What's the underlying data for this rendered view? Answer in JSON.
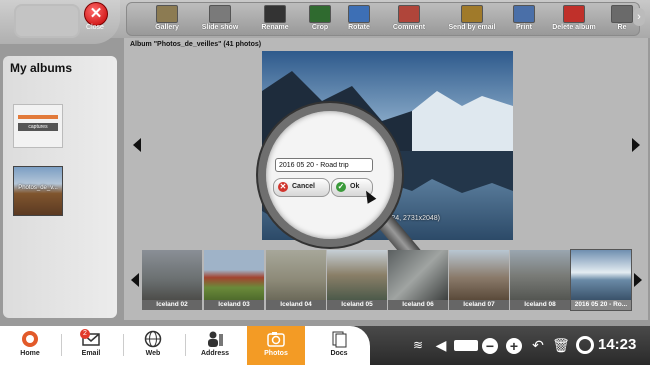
{
  "toolbar": {
    "close_label": "Close",
    "items": [
      {
        "label": "Gallery",
        "icon": "gallery-icon",
        "color": "#8c7b52"
      },
      {
        "label": "Slide show",
        "icon": "slideshow-icon",
        "color": "#7a7a7a"
      },
      {
        "label": "Rename",
        "icon": "rename-icon",
        "color": "#333333"
      },
      {
        "label": "Crop",
        "icon": "crop-icon",
        "color": "#2f6a2f"
      },
      {
        "label": "Rotate",
        "icon": "rotate-icon",
        "color": "#3d6fb5"
      },
      {
        "label": "Comment",
        "icon": "comment-icon",
        "color": "#b0453a"
      },
      {
        "label": "Send by email",
        "icon": "send-email-icon",
        "color": "#a07a2a"
      },
      {
        "label": "Print",
        "icon": "print-icon",
        "color": "#4a6fa8"
      },
      {
        "label": "Delete album",
        "icon": "delete-album-icon",
        "color": "#c0302a"
      },
      {
        "label": "Re",
        "icon": "more-icon",
        "color": "#6a6a6a"
      }
    ]
  },
  "sidebar": {
    "title": "My albums",
    "albums": [
      {
        "name": "captures"
      },
      {
        "name": "Photos_de_v..."
      }
    ]
  },
  "viewer": {
    "header": "Album \"Photos_de_veilles\" (41 photos)",
    "caption": "2016 05 20 - Road trip ... 2016 at 14h24, 2731x2048)"
  },
  "dialog": {
    "input_value": "2016 05 20 - Road trip",
    "cancel_label": "Cancel",
    "ok_label": "Ok"
  },
  "filmstrip": [
    {
      "caption": "Iceland 02"
    },
    {
      "caption": "Iceland 03"
    },
    {
      "caption": "Iceland 04"
    },
    {
      "caption": "Iceland 05"
    },
    {
      "caption": "Iceland 06"
    },
    {
      "caption": "Iceland 07"
    },
    {
      "caption": "Iceland 08"
    },
    {
      "caption": "2016 05 20 - Ro..."
    }
  ],
  "bottom_nav": [
    {
      "label": "Home",
      "icon": "home-icon"
    },
    {
      "label": "Email",
      "icon": "email-icon"
    },
    {
      "label": "Web",
      "icon": "web-icon"
    },
    {
      "label": "Address",
      "icon": "address-icon"
    },
    {
      "label": "Photos",
      "icon": "photos-icon"
    },
    {
      "label": "Docs",
      "icon": "docs-icon"
    }
  ],
  "email_badge": "2",
  "active_nav": "Photos",
  "clock": "14:23",
  "colors": {
    "accent": "#f39b25",
    "close": "#c30000"
  }
}
